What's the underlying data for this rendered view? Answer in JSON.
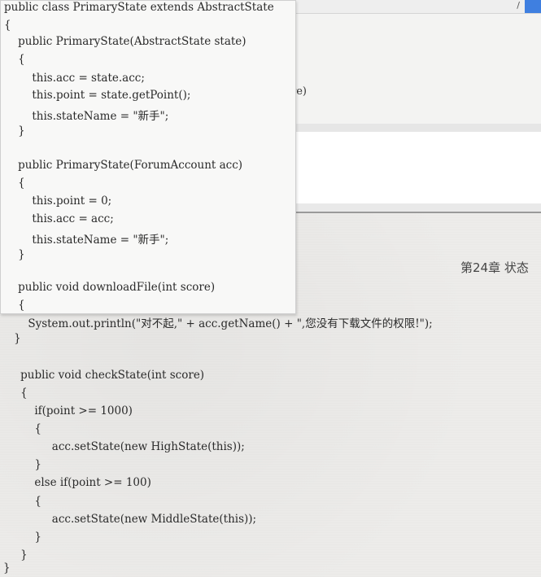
{
  "background_window": {
    "corner_tick": "/",
    "code_fragment": "re)"
  },
  "chapter_header": "第24章  状态",
  "popup_code": [
    "public class PrimaryState extends AbstractState",
    "{",
    "    public PrimaryState(AbstractState state)",
    "    {",
    "        this.acc = state.acc;",
    "        this.point = state.getPoint();",
    "        this.stateName = \"新手\";",
    "    }",
    "",
    "    public PrimaryState(ForumAccount acc)",
    "    {",
    "        this.point = 0;",
    "        this.acc = acc;",
    "        this.stateName = \"新手\";",
    "    }",
    "",
    "    public void downloadFile(int score)",
    "    {"
  ],
  "page_code": [
    "        System.out.println(\"对不起,\" + acc.getName() + \",您没有下载文件的权限!\");",
    "    }",
    "",
    "    public void checkState(int score)",
    "    {",
    "        if(point >= 1000)",
    "        {",
    "             acc.setState(new HighState(this));",
    "        }",
    "        else if(point >= 100)",
    "        {",
    "             acc.setState(new MiddleState(this));",
    "        }",
    "    }",
    "}"
  ]
}
